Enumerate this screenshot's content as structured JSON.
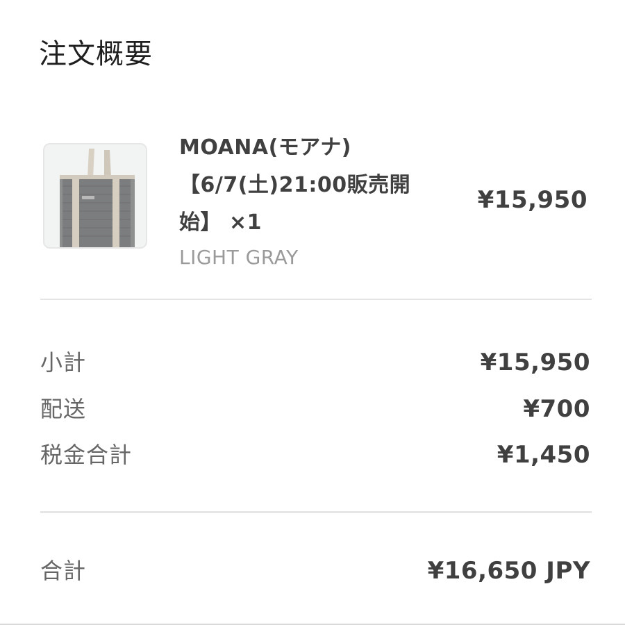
{
  "header": {
    "title": "注文概要"
  },
  "product": {
    "image_icon": "tote-bag-image",
    "title_lines": [
      "MOANA(モアナ)",
      "【6/7(土)21:00販売開",
      "始】 ×1"
    ],
    "variant": "LIGHT GRAY",
    "price": "¥15,950"
  },
  "summary": {
    "subtotal": {
      "label": "小計",
      "value": "¥15,950"
    },
    "shipping": {
      "label": "配送",
      "value": "¥700"
    },
    "tax": {
      "label": "税金合計",
      "value": "¥1,450"
    }
  },
  "total": {
    "label": "合計",
    "value": "¥16,650 JPY"
  },
  "colors": {
    "text_dark": "#404040",
    "text_muted": "#666666",
    "text_variant": "#9a9a9a",
    "divider": "#e4e4e4"
  }
}
